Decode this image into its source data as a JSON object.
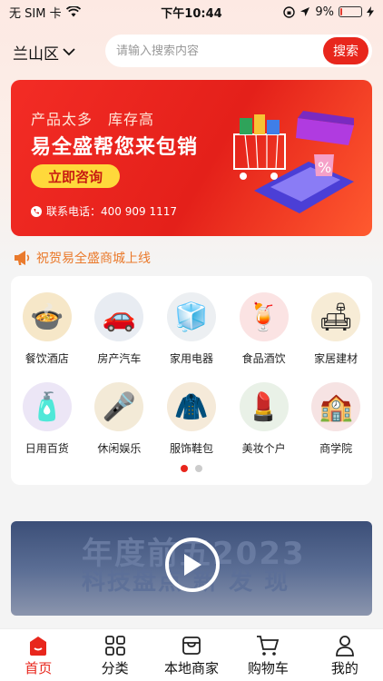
{
  "status_bar": {
    "carrier": "无 SIM 卡",
    "time": "下午10:44",
    "battery": "9%",
    "battery_level": 0.09
  },
  "header": {
    "location": "兰山区",
    "search_placeholder": "请输入搜索内容",
    "search_button": "搜索"
  },
  "banner": {
    "subtitle": "产品太多　库存高",
    "title": "易全盛帮您来包销",
    "cta": "立即咨询",
    "phone": "联系电话：400 909 1117"
  },
  "notice": {
    "text": "祝贺易全盛商城上线"
  },
  "categories": [
    {
      "label": "餐饮酒店",
      "icon": "food-icon",
      "glyph": "🍲",
      "bg": "#f6e7c8"
    },
    {
      "label": "房产汽车",
      "icon": "car-icon",
      "glyph": "🚗",
      "bg": "#e8ecf2"
    },
    {
      "label": "家用电器",
      "icon": "fridge-icon",
      "glyph": "🧊",
      "bg": "#eceff2"
    },
    {
      "label": "食品酒饮",
      "icon": "drink-icon",
      "glyph": "🍹",
      "bg": "#fbe3e3"
    },
    {
      "label": "家居建材",
      "icon": "sofa-icon",
      "glyph": "🛋",
      "bg": "#f7ecd6"
    },
    {
      "label": "日用百货",
      "icon": "detergent-icon",
      "glyph": "🧴",
      "bg": "#ece6f6"
    },
    {
      "label": "休闲娱乐",
      "icon": "microphone-icon",
      "glyph": "🎤",
      "bg": "#f3ead7"
    },
    {
      "label": "服饰鞋包",
      "icon": "coat-icon",
      "glyph": "🧥",
      "bg": "#f5ead9"
    },
    {
      "label": "美妆个户",
      "icon": "cosmetics-icon",
      "glyph": "💄",
      "bg": "#e9f1e7"
    },
    {
      "label": "商学院",
      "icon": "building-icon",
      "glyph": "🏫",
      "bg": "#f6e3e3"
    }
  ],
  "video": {
    "title_line1": "年度前五2023",
    "title_line2": "科技盘点 新 发 现"
  },
  "tabbar": {
    "items": [
      "首页",
      "分类",
      "本地商家",
      "购物车",
      "我的"
    ],
    "active": 0
  },
  "colors": {
    "accent": "#e8261c",
    "cta_yellow": "#ffd93b",
    "notice": "#ea7a2c"
  }
}
